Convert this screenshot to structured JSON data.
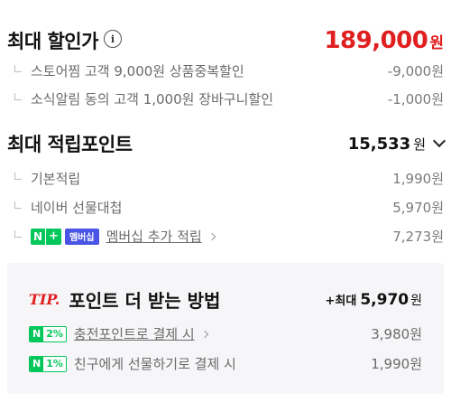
{
  "discount": {
    "title": "최대 할인가",
    "info_icon": "i",
    "total": "189,000",
    "unit": "원",
    "items": [
      {
        "label": "스토어찜 고객 9,000원 상품중복할인",
        "value": "-9,000원"
      },
      {
        "label": "소식알림 동의 고객 1,000원 장바구니할인",
        "value": "-1,000원"
      }
    ]
  },
  "points": {
    "title": "최대 적립포인트",
    "total": "15,533",
    "unit": "원",
    "items": [
      {
        "label": "기본적립",
        "value": "1,990원"
      },
      {
        "label": "네이버 선물대첩",
        "value": "5,970원"
      }
    ],
    "membership": {
      "badge_n": "N",
      "badge_plus": "+",
      "badge_member": "멤버십",
      "label": "멤버십 추가 적립",
      "value": "7,273원"
    }
  },
  "tip": {
    "label": "TIP.",
    "title": "포인트 더 받는 방법",
    "max_prefix": "+최대",
    "max_value": "5,970",
    "max_unit": "원",
    "items": [
      {
        "badge_n": "N",
        "badge_pct": "2%",
        "label": "충전포인트로 결제 시",
        "value": "3,980원"
      },
      {
        "badge_n": "N",
        "badge_pct": "1%",
        "label": "친구에게 선물하기로 결제 시",
        "value": "1,990원"
      }
    ]
  },
  "colors": {
    "accent_red": "#e02020",
    "naver_green": "#03c75a",
    "member_blue": "#4a55e6"
  }
}
